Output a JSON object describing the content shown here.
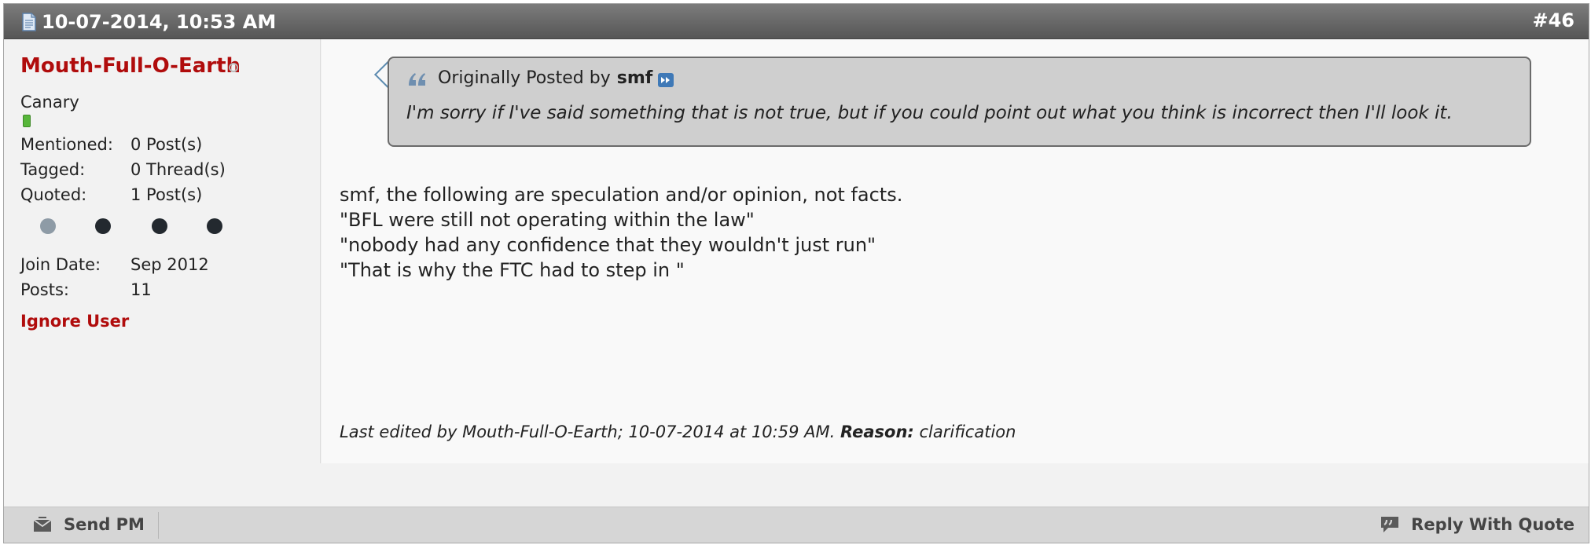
{
  "header": {
    "date": "10-07-2014, 10:53 AM",
    "post_number": "#46"
  },
  "user": {
    "name": "Mouth-Full-O-Earth",
    "title": "Canary",
    "stats": [
      {
        "label": "Mentioned:",
        "value": "0 Post(s)"
      },
      {
        "label": "Tagged:",
        "value": "0 Thread(s)"
      },
      {
        "label": "Quoted:",
        "value": "1 Post(s)"
      }
    ],
    "join_date": {
      "label": "Join Date:",
      "value": "Sep 2012"
    },
    "posts": {
      "label": "Posts:",
      "value": "11"
    },
    "ignore_label": "Ignore User"
  },
  "quote": {
    "prefix": "Originally Posted by",
    "author": "smf",
    "text": "I'm sorry if I've said something that is not true, but if you could point out what you think is incorrect then I'll look it."
  },
  "message": {
    "lines": [
      "smf, the following are speculation and/or opinion, not facts.",
      "\"BFL were still not operating within the law\"",
      "\"nobody had any confidence that they wouldn't just run\"",
      "\"That is why the FTC had to step in \""
    ]
  },
  "edit_note": {
    "text": "Last edited by Mouth-Full-O-Earth; 10-07-2014 at 10:59 AM.",
    "reason_label": "Reason:",
    "reason": "clarification"
  },
  "footer": {
    "send_pm_label": "Send PM",
    "reply_quote_label": "Reply With Quote"
  },
  "colors": {
    "username": "#b00c0c",
    "header_bg": "#6a6a6a",
    "quote_bg": "#cfcfcf",
    "reputation": "#57b63a"
  },
  "icons": {
    "header": "document-icon",
    "quote": "quote-marks-icon",
    "jump": "jump-to-post-icon",
    "send_pm": "envelope-icon",
    "reply": "speech-bubble-icon"
  }
}
